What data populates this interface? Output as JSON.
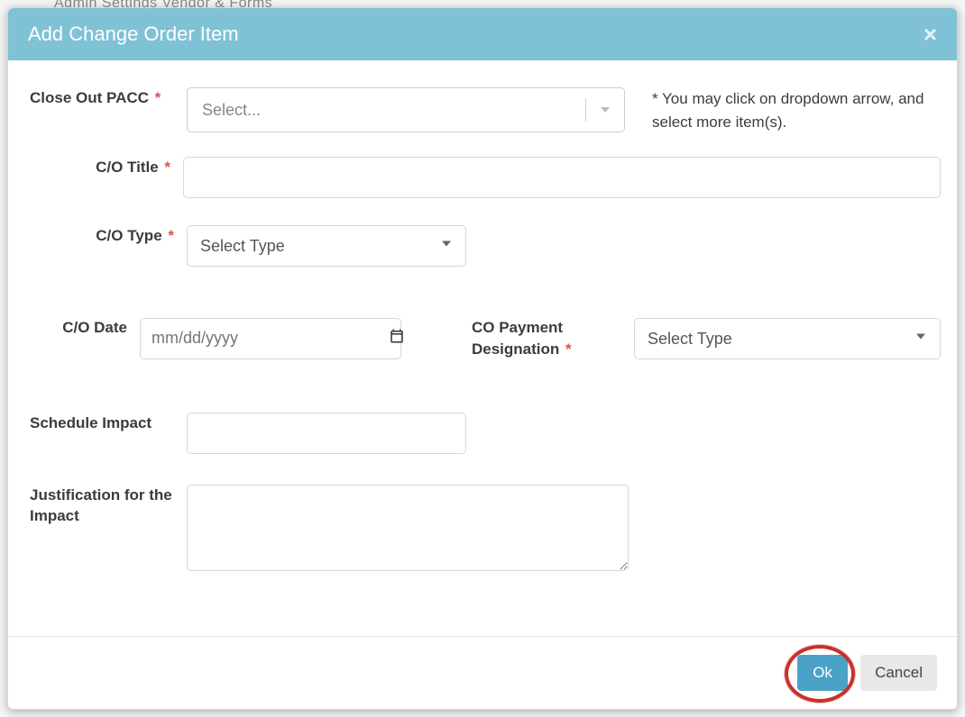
{
  "background": {
    "nav_hint": "Admin    Settings    Vendor & Forms"
  },
  "modal": {
    "title": "Add Change Order Item",
    "help_text": "* You may click on dropdown arrow, and select more item(s).",
    "labels": {
      "close_out_pacc": "Close Out PACC",
      "co_title": "C/O Title",
      "co_type": "C/O Type",
      "co_date": "C/O Date",
      "co_payment_designation": "CO Payment Designation",
      "schedule_impact": "Schedule Impact",
      "justification": "Justification for the Impact"
    },
    "placeholders": {
      "close_out_pacc": "Select...",
      "co_type": "Select Type",
      "co_date": "mm/dd/yyyy",
      "co_payment_designation": "Select Type"
    },
    "values": {
      "co_title": "",
      "co_date": "",
      "schedule_impact": "",
      "justification": ""
    },
    "buttons": {
      "ok": "Ok",
      "cancel": "Cancel"
    }
  }
}
